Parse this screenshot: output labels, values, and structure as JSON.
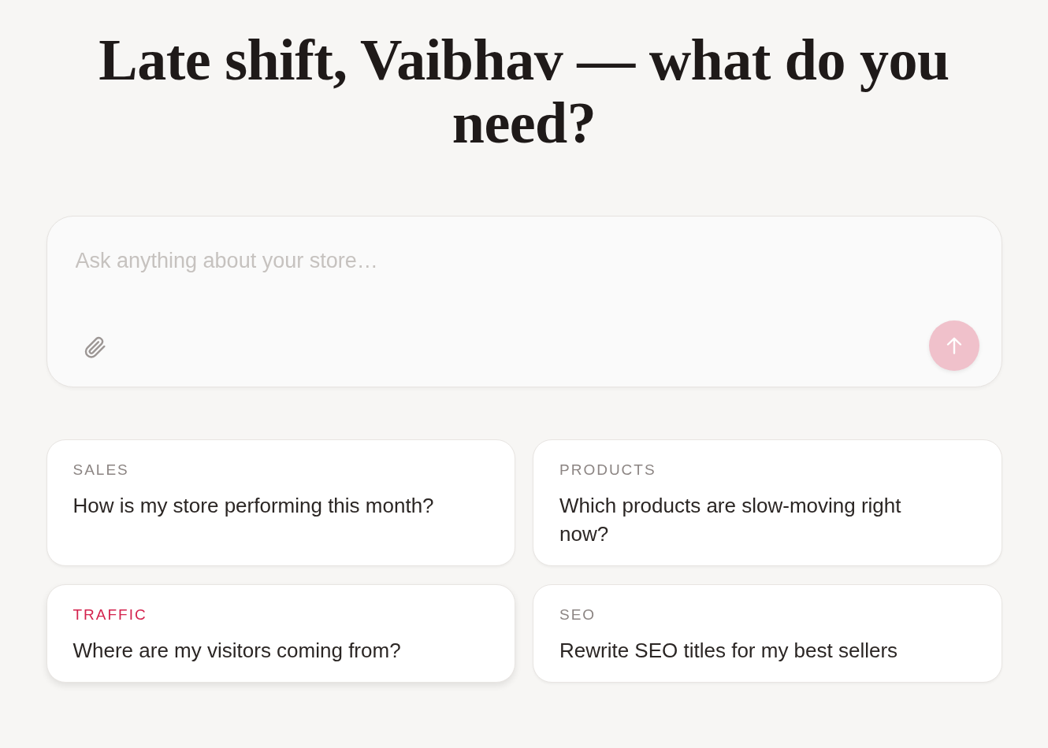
{
  "heading": "Late shift, Vaibhav — what do you need?",
  "composer": {
    "placeholder": "Ask anything about your store…",
    "send_button": {
      "disabled": true
    }
  },
  "suggestions": [
    {
      "category": "SALES",
      "question": "How is my store performing this month?",
      "highlighted": false
    },
    {
      "category": "PRODUCTS",
      "question": "Which products are slow-moving right now?",
      "highlighted": false
    },
    {
      "category": "TRAFFIC",
      "question": "Where are my visitors coming from?",
      "highlighted": true
    },
    {
      "category": "SEO",
      "question": "Rewrite SEO titles for my best sellers",
      "highlighted": false
    }
  ]
}
